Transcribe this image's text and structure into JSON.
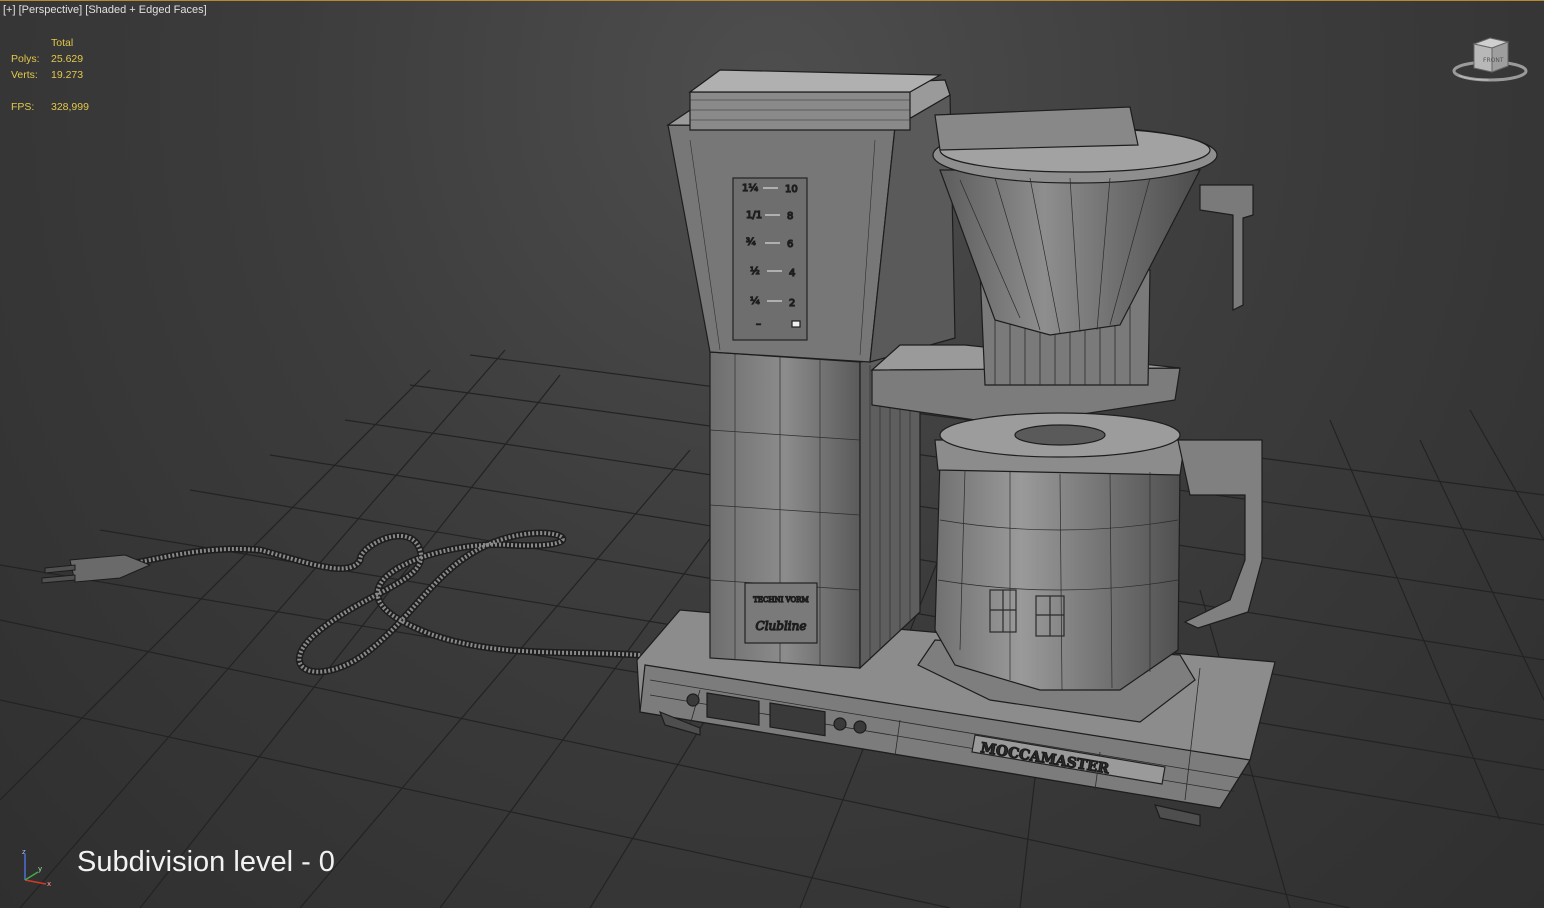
{
  "viewport": {
    "menu_plus": "[+]",
    "view_name": "[Perspective]",
    "shading_mode": "[Shaded + Edged Faces]"
  },
  "stats": {
    "header": "Total",
    "polys_label": "Polys:",
    "polys_value": "25.629",
    "verts_label": "Verts:",
    "verts_value": "19.273",
    "fps_label": "FPS:",
    "fps_value": "328,999"
  },
  "overlay": {
    "subdivision_text": "Subdivision level - 0"
  },
  "model": {
    "water_scale_left": [
      "1¼",
      "1/1",
      "¾",
      "½",
      "¼",
      "–"
    ],
    "water_scale_right": [
      "10",
      "8",
      "6",
      "4",
      "2"
    ],
    "logo_text": "TECHNI VORM",
    "line_text": "Clubline",
    "brand_text": "MOCCAMASTER"
  },
  "viewcube": {
    "face_label": "FRONT"
  },
  "axes": {
    "x": "x",
    "y": "y",
    "z": "z"
  },
  "colors": {
    "background": "#3c3c3c",
    "grid": "#232323",
    "stats_text": "#e3c84a",
    "border_accent": "#b48a2c",
    "model_shade": "#8a8a8a"
  }
}
